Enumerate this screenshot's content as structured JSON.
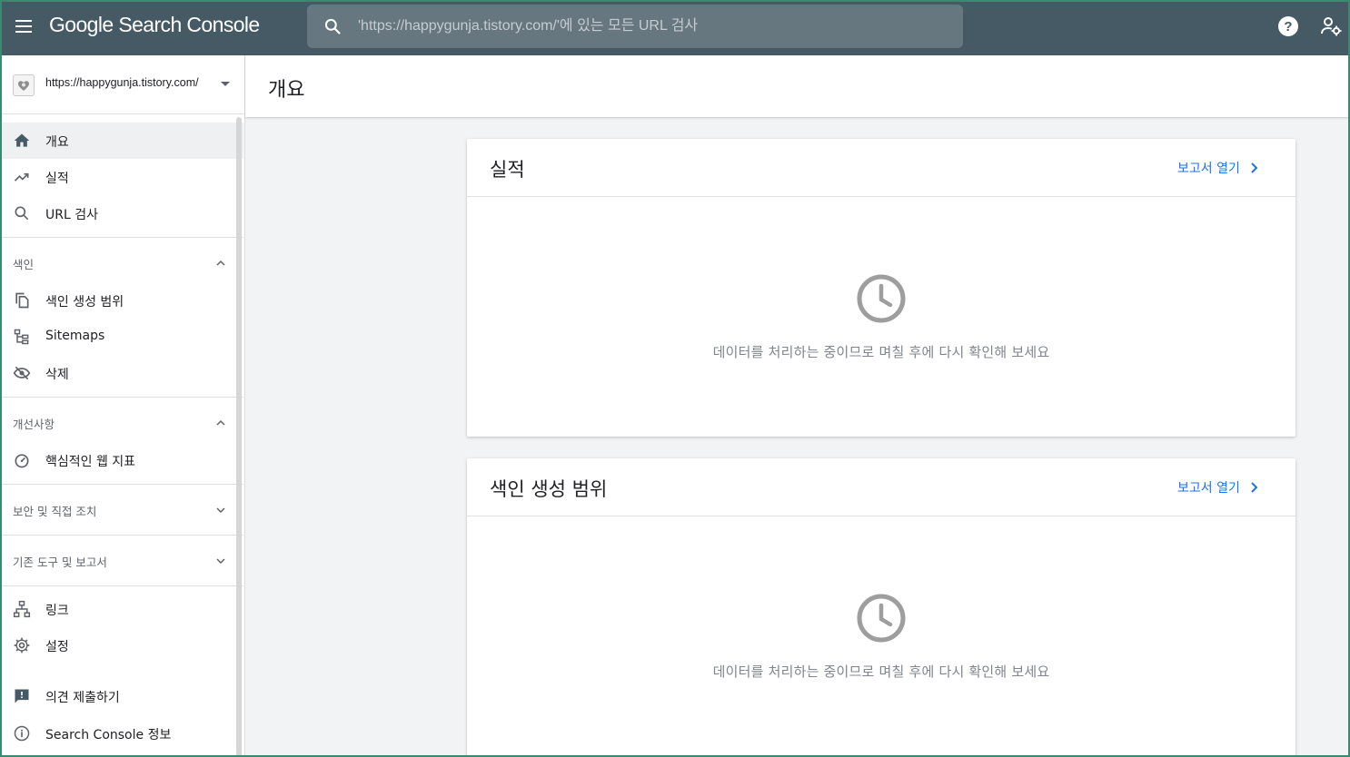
{
  "header": {
    "logo_text": "Google Search Console",
    "search_placeholder": "'https://happygunja.tistory.com/'에 있는 모든 URL 검사"
  },
  "sidebar": {
    "property_url": "https://happygunja.tistory.com/",
    "primary": [
      {
        "label": "개요",
        "icon": "home-icon",
        "active": true
      },
      {
        "label": "실적",
        "icon": "trending-up-icon"
      },
      {
        "label": "URL 검사",
        "icon": "search-icon"
      }
    ],
    "sections": [
      {
        "title": "색인",
        "expanded": true,
        "items": [
          {
            "label": "색인 생성 범위",
            "icon": "copy-icon"
          },
          {
            "label": "Sitemaps",
            "icon": "sitemap-icon"
          },
          {
            "label": "삭제",
            "icon": "eye-off-icon"
          }
        ]
      },
      {
        "title": "개선사항",
        "expanded": true,
        "items": [
          {
            "label": "핵심적인 웹 지표",
            "icon": "speed-gauge-icon"
          }
        ]
      },
      {
        "title": "보안 및 직접 조치",
        "expanded": false,
        "items": []
      },
      {
        "title": "기존 도구 및 보고서",
        "expanded": false,
        "items": []
      }
    ],
    "bottom": [
      {
        "label": "링크",
        "icon": "links-icon"
      },
      {
        "label": "설정",
        "icon": "settings-icon"
      },
      {
        "label": "의견 제출하기",
        "icon": "feedback-icon"
      },
      {
        "label": "Search Console 정보",
        "icon": "info-icon"
      }
    ]
  },
  "main": {
    "page_title": "개요",
    "cards": [
      {
        "title": "실적",
        "link_label": "보고서 열기",
        "message": "데이터를 처리하는 중이므로 며칠 후에 다시 확인해 보세요"
      },
      {
        "title": "색인 생성 범위",
        "link_label": "보고서 열기",
        "message": "데이터를 처리하는 중이므로 며칠 후에 다시 확인해 보세요"
      }
    ]
  },
  "colors": {
    "header_bg": "#455a64",
    "link": "#1a73e8",
    "active_nav_bg": "#eef0f1"
  }
}
